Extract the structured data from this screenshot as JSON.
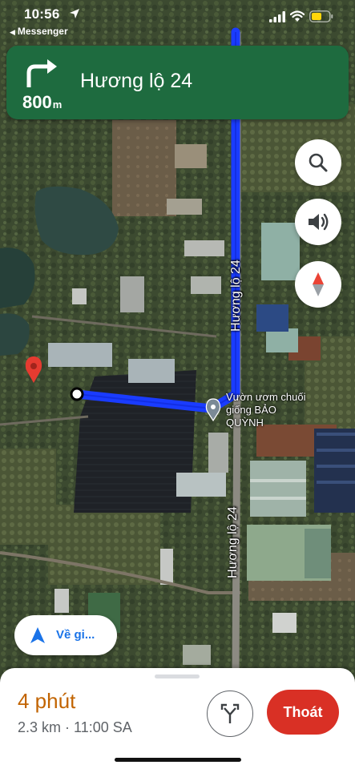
{
  "status_bar": {
    "time": "10:56",
    "back_app": "Messenger"
  },
  "navigation": {
    "distance_value": "800",
    "distance_unit": "m",
    "street_name": "Hương lộ 24",
    "turn_direction": "turn-right-icon"
  },
  "map": {
    "road_label_top": "Hương lộ 24",
    "road_label_bottom": "Hương lộ 24",
    "place_name": "Vườn ươm chuối giống BẢO QUỲNH"
  },
  "buttons": {
    "search_icon": "search-icon",
    "sound_icon": "volume-icon",
    "compass_icon": "compass-icon",
    "recenter_label": "Về gi..."
  },
  "trip": {
    "duration": "4 phút",
    "details": "2.3 km · 11:00 SA",
    "exit_label": "Thoát"
  },
  "colors": {
    "banner": "#1e6b3f",
    "route": "#1a3cff",
    "eta": "#c26401",
    "exit": "#d93025"
  }
}
